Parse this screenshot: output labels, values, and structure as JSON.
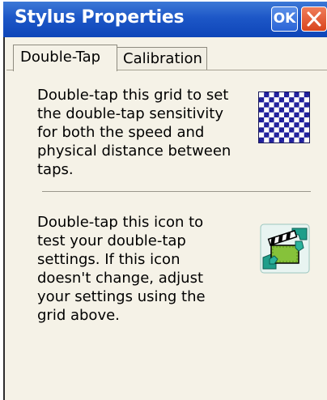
{
  "window": {
    "title": "Stylus Properties",
    "ok_label": "OK"
  },
  "tabs": [
    {
      "label": "Double-Tap",
      "selected": true
    },
    {
      "label": "Calibration",
      "selected": false
    }
  ],
  "double_tap": {
    "grid_instructions": "Double-tap this grid to set the double-tap sensitivity for both the speed and physical distance between taps.",
    "icon_instructions": "Double-tap this icon to test your double-tap settings. If this icon doesn't change, adjust your settings using the grid above."
  },
  "icons": {
    "close": "close-icon",
    "grid": "checkerboard-grid-icon",
    "test": "clapperboard-test-icon"
  },
  "colors": {
    "titlebar": "#1d57c7",
    "close_button": "#d9441d",
    "dialog_background": "#f5f2e7",
    "grid_blue": "#1c1c9a"
  }
}
